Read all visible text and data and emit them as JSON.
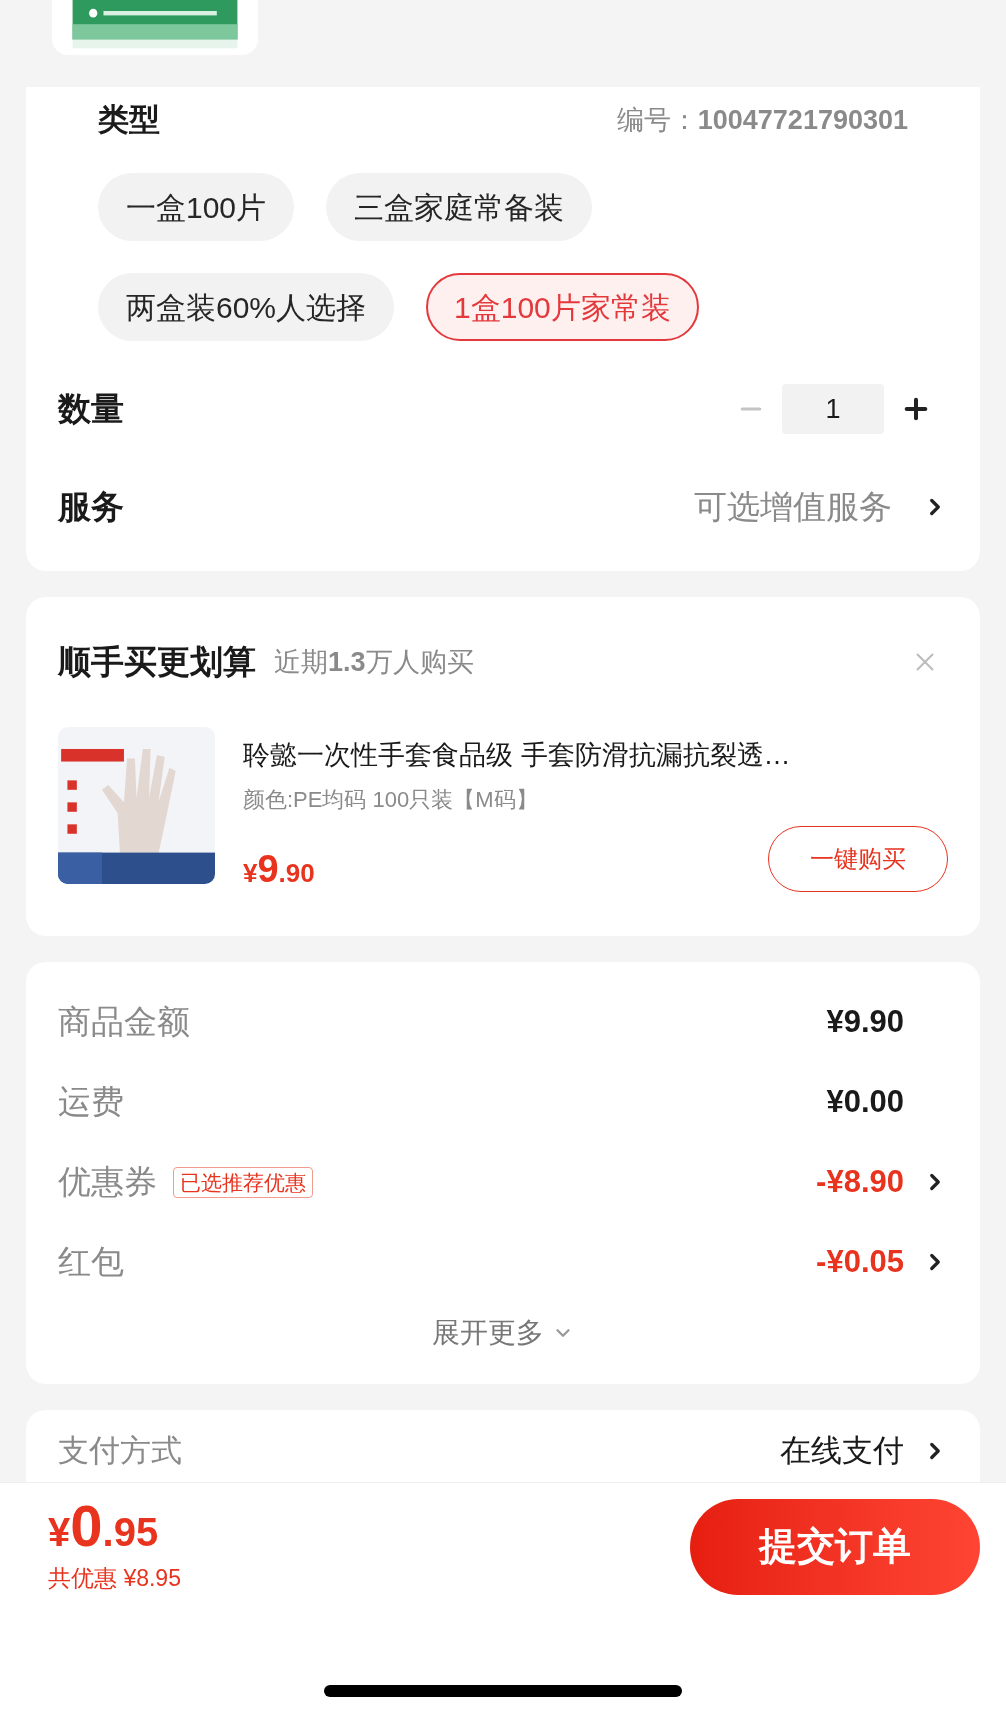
{
  "spec": {
    "type_label": "类型",
    "code_label": "编号：",
    "code_value": "10047721790301",
    "options": [
      {
        "label": "一盒100片",
        "selected": false
      },
      {
        "label": "三盒家庭常备装",
        "selected": false
      },
      {
        "label": "两盒装60%人选择",
        "selected": false
      },
      {
        "label": "1盒100片家常装",
        "selected": true
      }
    ],
    "quantity": {
      "label": "数量",
      "value": "1",
      "minus_disabled": true
    },
    "service": {
      "label": "服务",
      "value": "可选增值服务"
    }
  },
  "bundle": {
    "title": "顺手买更划算",
    "subtitle": "近期**1.3**万人购买",
    "product": {
      "name": "聆懿一次性手套食品级 手套防滑抗漏抗裂透…",
      "variant": "颜色:PE均码 100只装【M码】",
      "currency": "¥",
      "price_int": "9",
      "price_dec": ".90",
      "button": "一键购买"
    }
  },
  "summary": {
    "rows": [
      {
        "kind": "plain",
        "label": "商品金额",
        "value": "¥9.90"
      },
      {
        "kind": "plain",
        "label": "运费",
        "value": "¥0.00"
      },
      {
        "kind": "discount",
        "label": "优惠券",
        "tag": "已选推荐优惠",
        "value": "-¥8.90"
      },
      {
        "kind": "discount",
        "label": "红包",
        "value": "-¥0.05"
      }
    ],
    "expand": "展开更多"
  },
  "payment": {
    "label": "支付方式",
    "value": "在线支付"
  },
  "footer": {
    "currency": "¥",
    "total_int": "0",
    "total_dec": ".95",
    "saving": "共优惠 ¥8.95",
    "submit": "提交订单"
  }
}
